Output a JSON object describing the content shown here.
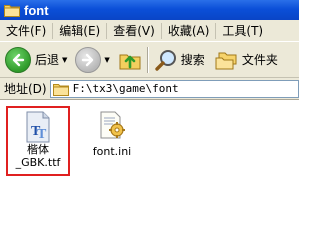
{
  "window": {
    "title": "font"
  },
  "menu": {
    "items": [
      {
        "label": "文件(F)"
      },
      {
        "label": "编辑(E)"
      },
      {
        "label": "查看(V)"
      },
      {
        "label": "收藏(A)"
      },
      {
        "label": "工具(T)"
      }
    ]
  },
  "toolbar": {
    "back_label": "后退",
    "search_label": "搜索",
    "folders_label": "文件夹"
  },
  "address": {
    "label": "地址(D)",
    "value": "F:\\tx3\\game\\font"
  },
  "files": [
    {
      "name_line1": "楷体",
      "name_line2": "_GBK.ttf",
      "icon": "truetype-font-icon",
      "selected": true
    },
    {
      "name_line1": "font.ini",
      "icon": "config-settings-file-icon",
      "selected": false
    }
  ],
  "colors": {
    "titlebar": "#0b4fd8",
    "chrome": "#ece9d8",
    "selection_outline": "#e02020"
  }
}
